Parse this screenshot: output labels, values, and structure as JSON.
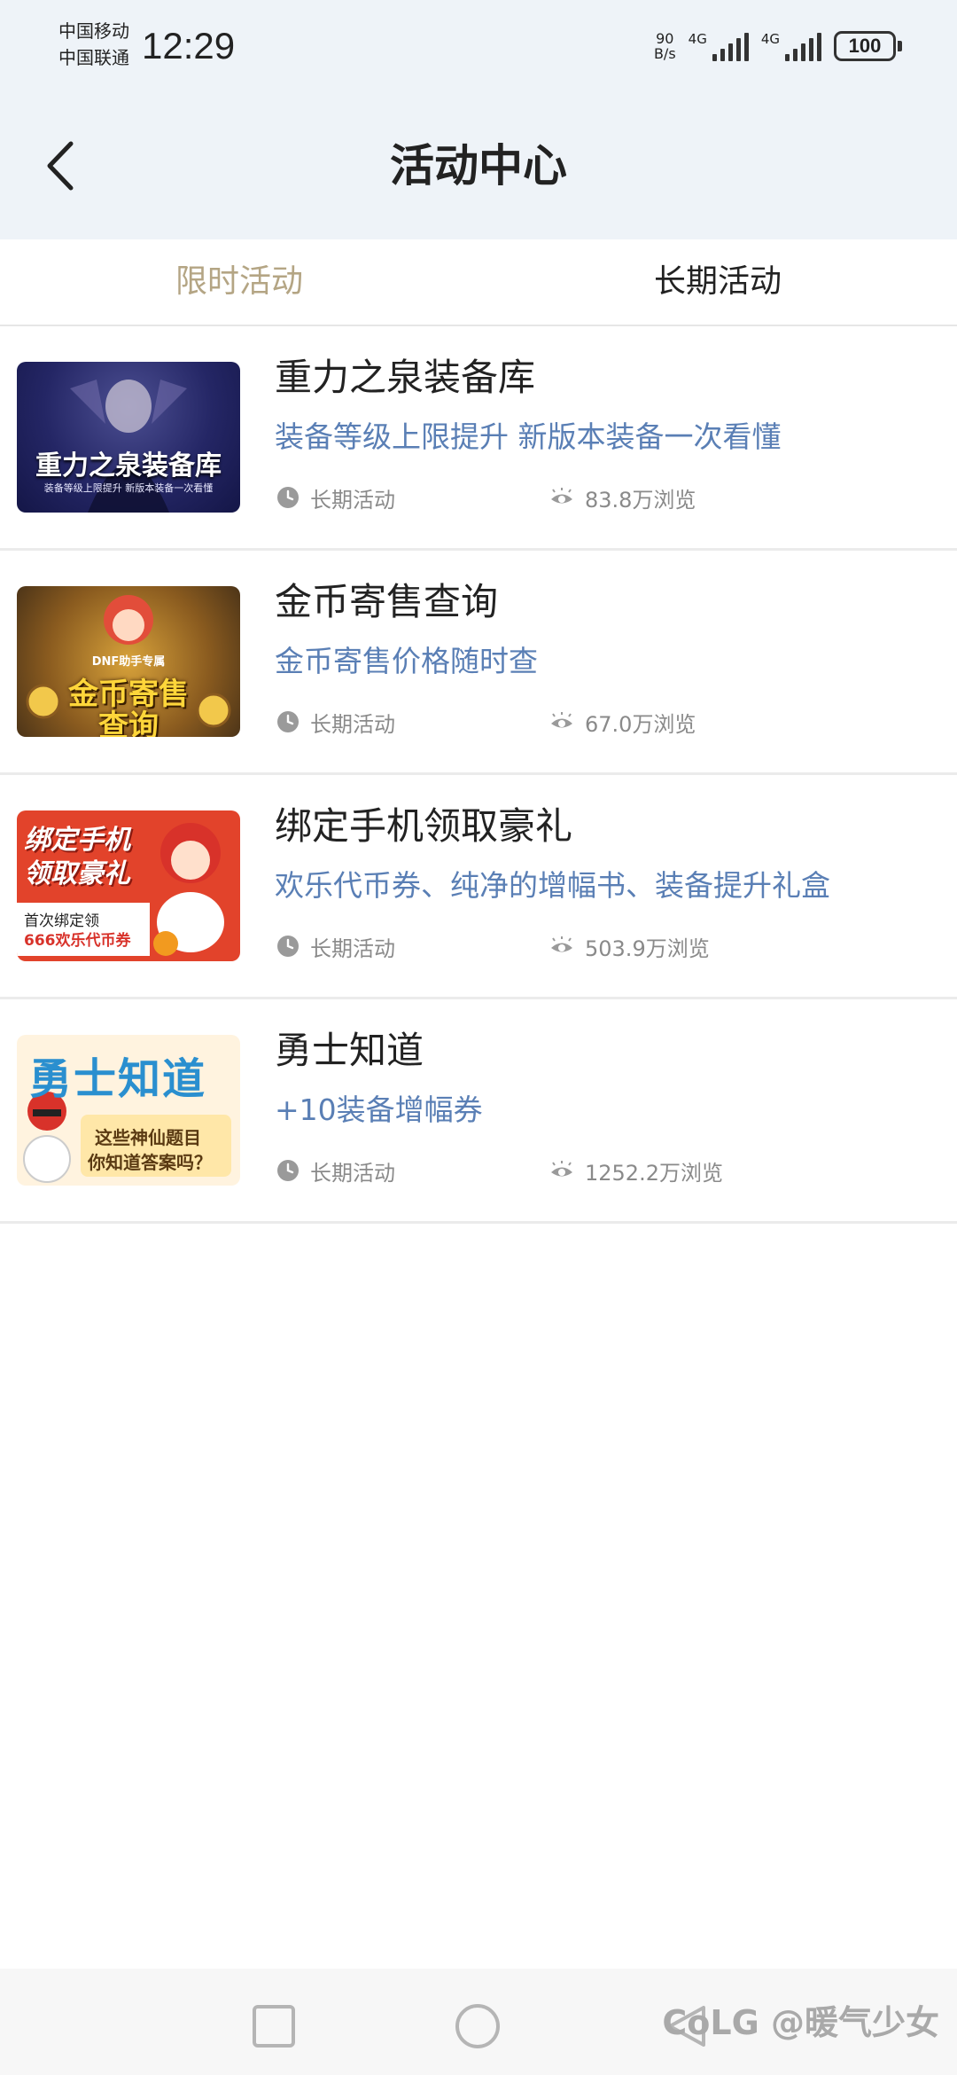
{
  "status_bar": {
    "carrier_1": "中国移动",
    "carrier_2": "中国联通",
    "time": "12:29",
    "net_speed_value": "90",
    "net_speed_unit": "B/s",
    "signal_1_label": "4G",
    "signal_2_label": "4G",
    "battery": "100"
  },
  "header": {
    "title": "活动中心",
    "back_icon": "chevron-left-icon"
  },
  "tabs": [
    {
      "label": "限时活动",
      "active": false
    },
    {
      "label": "长期活动",
      "active": true
    }
  ],
  "activities": [
    {
      "title": "重力之泉装备库",
      "description": "装备等级上限提升 新版本装备一次看懂",
      "type": "长期活动",
      "views": "83.8万浏览",
      "thumb_title": "重力之泉装备库",
      "thumb_subtitle": "装备等级上限提升  新版本装备一次看懂"
    },
    {
      "title": "金币寄售查询",
      "description": "金币寄售价格随时查",
      "type": "长期活动",
      "views": "67.0万浏览",
      "thumb_badge": "DNF助手专属",
      "thumb_title": "金币寄售",
      "thumb_subtitle": "查询"
    },
    {
      "title": "绑定手机领取豪礼",
      "description": "欢乐代币券、纯净的增幅书、装备提升礼盒",
      "type": "长期活动",
      "views": "503.9万浏览",
      "thumb_title": "绑定手机",
      "thumb_title_2": "领取豪礼",
      "thumb_note": "首次绑定领",
      "thumb_note_2": "666欢乐代币券"
    },
    {
      "title": "勇士知道",
      "description": "+10装备增幅券",
      "type": "长期活动",
      "views": "1252.2万浏览",
      "thumb_title": "勇士知道",
      "thumb_note": "这些神仙题目",
      "thumb_note_2": "你知道答案吗？"
    }
  ],
  "navbar": {
    "recent_icon": "square-icon",
    "home_icon": "circle-icon",
    "back_icon": "triangle-back-icon"
  },
  "watermark": "CoLG @暖气少女",
  "colors": {
    "header_bg": "#eef3f8",
    "tab_inactive": "#b4a584",
    "description_blue": "#5a7fb5",
    "meta_gray": "#8a8a8a"
  }
}
